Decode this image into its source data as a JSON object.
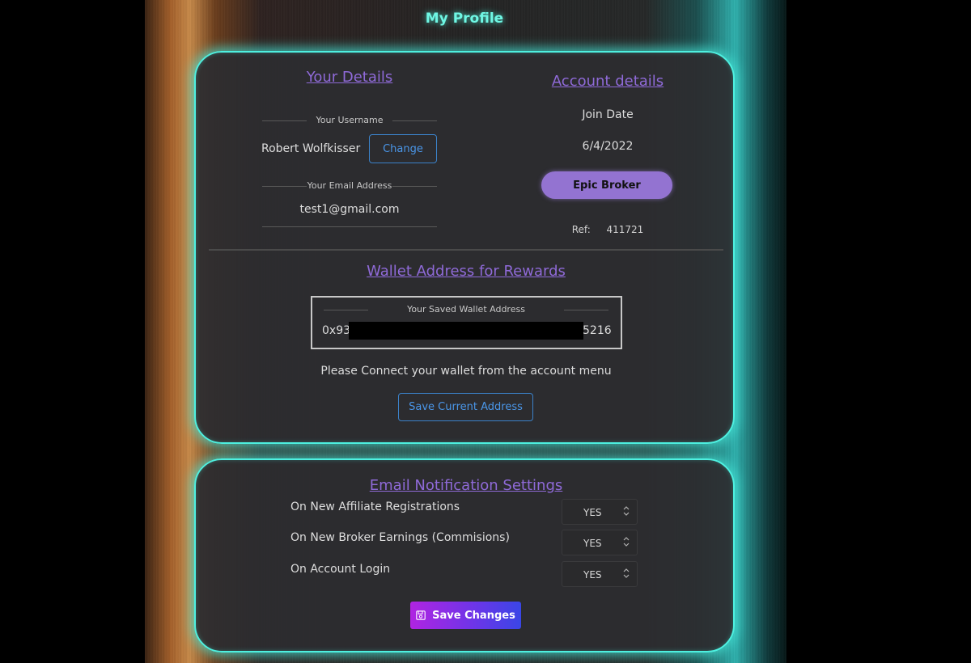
{
  "page": {
    "title": "My Profile"
  },
  "your_details": {
    "heading": "Your Details",
    "username_label": "Your Username",
    "username": "Robert Wolfkisser",
    "change_button": "Change",
    "email_label": "Your Email Address",
    "email": "test1@gmail.com"
  },
  "account_details": {
    "heading": "Account details",
    "join_date_label": "Join Date",
    "join_date": "6/4/2022",
    "rank_badge": "Epic Broker",
    "ref_label": "Ref:",
    "ref_value": "411721"
  },
  "wallet": {
    "heading": "Wallet Address for Rewards",
    "saved_label": "Your Saved Wallet Address",
    "address_prefix": "0x93",
    "address_suffix": "5216",
    "connect_message": "Please Connect your wallet from the account menu",
    "save_current_button": "Save Current Address"
  },
  "notifications": {
    "heading": "Email Notification Settings",
    "items": [
      {
        "label": "On New Affiliate Registrations",
        "value": "YES"
      },
      {
        "label": "On New Broker Earnings (Commisions)",
        "value": "YES"
      },
      {
        "label": "On Account Login",
        "value": "YES"
      }
    ],
    "save_button": "Save Changes",
    "save_icon": "floppy-disk-icon"
  },
  "colors": {
    "accent_cyan": "#4ef0e0",
    "heading_purple": "#8f6ad8",
    "link_blue": "#4a96e8",
    "badge_purple": "#9373d1"
  }
}
